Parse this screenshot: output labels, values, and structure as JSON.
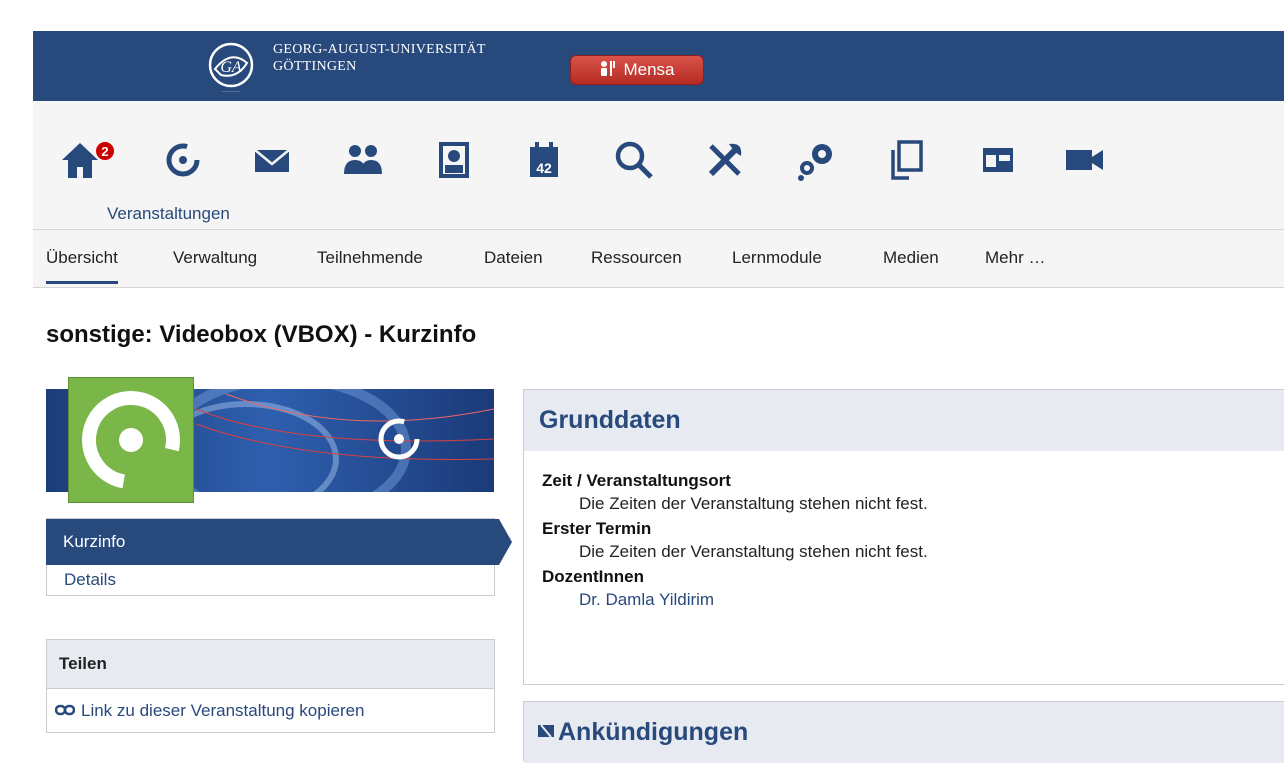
{
  "topbar": {
    "university_line1": "GEORG-AUGUST-UNIVERSITÄT",
    "university_line2": "GÖTTINGEN",
    "mensa_label": "Mensa"
  },
  "iconbar": {
    "home_badge": "2",
    "active_label": "Veranstaltungen",
    "icons": [
      "home-icon",
      "courses-icon",
      "mail-icon",
      "community-icon",
      "profile-icon",
      "calendar-icon",
      "search-icon",
      "tools-icon",
      "admin-icon",
      "files-icon",
      "dashboard-icon",
      "video-icon"
    ]
  },
  "tabs": [
    "Übersicht",
    "Verwaltung",
    "Teilnehmende",
    "Dateien",
    "Ressourcen",
    "Lernmodule",
    "Medien",
    "Mehr …"
  ],
  "page_title": "sonstige: Videobox (VBOX) - Kurzinfo",
  "sidenav": [
    "Kurzinfo",
    "Details"
  ],
  "share": {
    "title": "Teilen",
    "link_label": "Link zu dieser Veranstaltung kopieren"
  },
  "grunddaten": {
    "title": "Grunddaten",
    "rows": [
      {
        "label": "Zeit / Veranstaltungsort",
        "value": "Die Zeiten der Veranstaltung stehen nicht fest."
      },
      {
        "label": "Erster Termin",
        "value": "Die Zeiten der Veranstaltung stehen nicht fest."
      },
      {
        "label": "DozentInnen",
        "value": "Dr. Damla Yildirim"
      }
    ]
  },
  "ankuendigungen": {
    "title": "Ankündigungen"
  },
  "colors": {
    "brand": "#28497c",
    "mensa": "#c9372e",
    "course_green": "#7ab648"
  }
}
